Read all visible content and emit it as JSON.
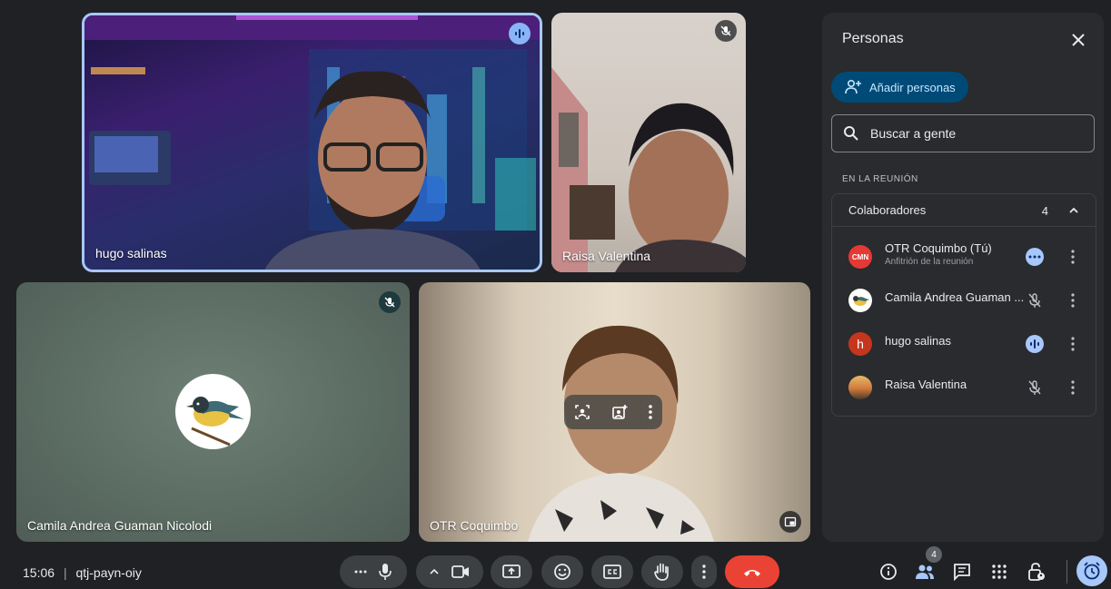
{
  "tiles": {
    "hugo": {
      "name": "hugo salinas"
    },
    "raisa": {
      "name": "Raisa Valentina"
    },
    "camila": {
      "name": "Camila Andrea Guaman Nicolodi"
    },
    "otr": {
      "name": "OTR Coquimbo"
    }
  },
  "panel": {
    "title": "Personas",
    "add_label": "Añadir personas",
    "search_placeholder": "Buscar a gente",
    "section_label": "EN LA REUNIÓN",
    "group": {
      "label": "Colaboradores",
      "count": "4"
    },
    "people": [
      {
        "name": "OTR Coquimbo (Tú)",
        "sub": "Anfitrión de la reunión",
        "avatar_text": "CMN"
      },
      {
        "name": "Camila Andrea Guaman ..."
      },
      {
        "name": "hugo salinas",
        "avatar_letter": "h"
      },
      {
        "name": "Raisa Valentina"
      }
    ]
  },
  "bottom": {
    "time": "15:06",
    "separator": "|",
    "meeting_code": "qtj-payn-oiy",
    "participants_badge": "4"
  },
  "colors": {
    "background": "#202124",
    "panel": "#2a2b2e",
    "accent": "#8ab4f8",
    "end_call": "#ea4335",
    "add_button": "#004a77"
  }
}
